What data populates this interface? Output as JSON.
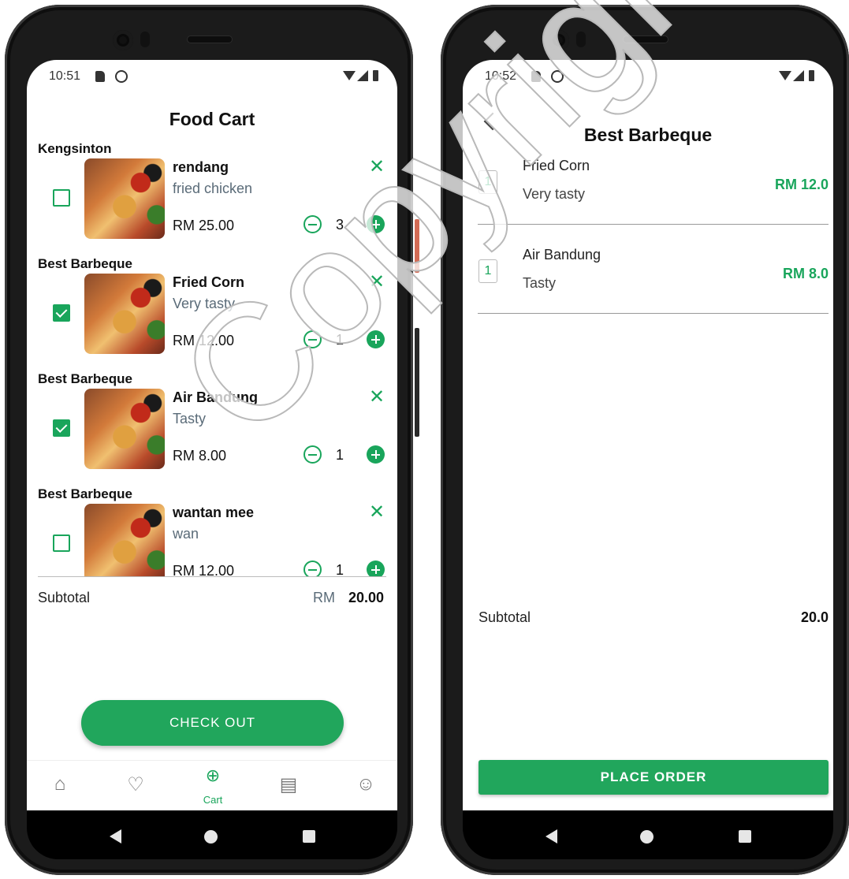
{
  "left": {
    "status": {
      "time": "10:51"
    },
    "title": "Food Cart",
    "items": [
      {
        "shop": "Kengsinton",
        "name": "rendang",
        "desc": "fried chicken",
        "price": "RM 25.00",
        "qty": "3",
        "checked": false
      },
      {
        "shop": "Best Barbeque",
        "name": "Fried Corn",
        "desc": "Very tasty",
        "price": "RM 12.00",
        "qty": "1",
        "checked": true
      },
      {
        "shop": "Best Barbeque",
        "name": "Air Bandung",
        "desc": "Tasty",
        "price": "RM 8.00",
        "qty": "1",
        "checked": true
      },
      {
        "shop": "Best Barbeque",
        "name": "wantan mee",
        "desc": "wan",
        "price": "RM 12.00",
        "qty": "1",
        "checked": false
      }
    ],
    "subtotal_label": "Subtotal",
    "subtotal_currency": "RM",
    "subtotal_amount": "20.00",
    "checkout_label": "CHECK OUT",
    "nav": [
      {
        "icon": "home-icon",
        "glyph": "⌂",
        "label": ""
      },
      {
        "icon": "favorites-icon",
        "glyph": "♡",
        "label": ""
      },
      {
        "icon": "cart-icon",
        "glyph": "🛒",
        "label": "Cart"
      },
      {
        "icon": "news-icon",
        "glyph": "▤",
        "label": ""
      },
      {
        "icon": "profile-icon",
        "glyph": "☺",
        "label": ""
      }
    ]
  },
  "right": {
    "status": {
      "time": "10:52"
    },
    "title": "Best Barbeque",
    "items": [
      {
        "qty": "1",
        "name": "Fried Corn",
        "desc": "Very tasty",
        "price": "RM 12.0"
      },
      {
        "qty": "1",
        "name": "Air Bandung",
        "desc": "Tasty",
        "price": "RM 8.0"
      }
    ],
    "subtotal_label": "Subtotal",
    "subtotal_amount": "20.0",
    "place_order_label": "PLACE ORDER"
  },
  "watermark": "Copyright@FTSM UKM",
  "colors": {
    "accent": "#21a65c",
    "desc_text": "#5a6b78"
  }
}
